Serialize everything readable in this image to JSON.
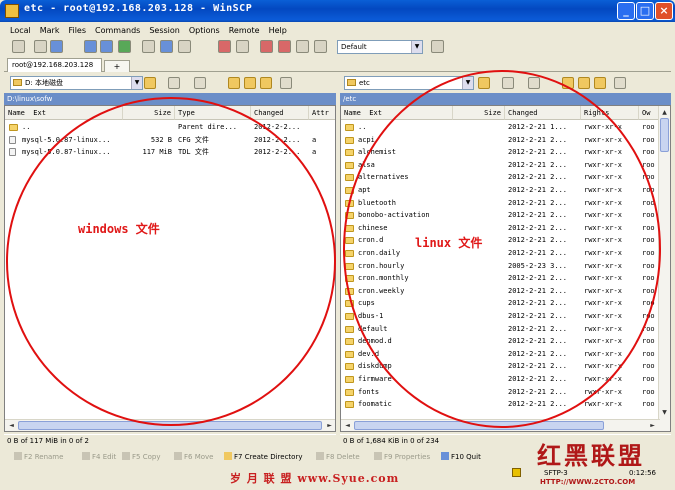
{
  "window": {
    "title": "etc - root@192.168.203.128 - WinSCP",
    "minimize": "_",
    "maximize": "□",
    "close": "×"
  },
  "menu": [
    "Local",
    "Mark",
    "Files",
    "Commands",
    "Session",
    "Options",
    "Remote",
    "Help"
  ],
  "toolbar": {
    "transfer_preset": "Default"
  },
  "tab": {
    "label": "root@192.168.203.128",
    "add": "+"
  },
  "left": {
    "path_combo": "D: 本地磁盘",
    "path": "D:\\linux\\sofw",
    "columns": [
      "Name",
      "Ext",
      "Size",
      "Type",
      "Changed",
      "Attr"
    ],
    "rows": [
      {
        "name": "..",
        "size": "",
        "type": "Parent dire...",
        "changed": "2012-2-2...",
        "attr": ""
      },
      {
        "name": "mysql-5.0.87-linux...",
        "size": "532 B",
        "type": "CFG 文件",
        "changed": "2012-2-2...",
        "attr": "a"
      },
      {
        "name": "mysql-5.0.87-linux...",
        "size": "117 MiB",
        "type": "TDL 文件",
        "changed": "2012-2-2...",
        "attr": "a"
      }
    ],
    "status": "0 B of 117 MiB in 0 of 2",
    "annotation": "windows 文件"
  },
  "right": {
    "path_combo": "etc",
    "path": "/etc",
    "columns": [
      "Name",
      "Ext",
      "Size",
      "Changed",
      "Rights",
      "Ow"
    ],
    "rows": [
      {
        "name": "..",
        "changed": "2012-2-21 1...",
        "rights": "rwxr-xr-x",
        "owner": "roo"
      },
      {
        "name": "acpi",
        "changed": "2012-2-21 2...",
        "rights": "rwxr-xr-x",
        "owner": "roo"
      },
      {
        "name": "alchemist",
        "changed": "2012-2-21 2...",
        "rights": "rwxr-xr-x",
        "owner": "roo"
      },
      {
        "name": "alsa",
        "changed": "2012-2-21 2...",
        "rights": "rwxr-xr-x",
        "owner": "roo"
      },
      {
        "name": "alternatives",
        "changed": "2012-2-21 2...",
        "rights": "rwxr-xr-x",
        "owner": "roo"
      },
      {
        "name": "apt",
        "changed": "2012-2-21 2...",
        "rights": "rwxr-xr-x",
        "owner": "roo"
      },
      {
        "name": "bluetooth",
        "changed": "2012-2-21 2...",
        "rights": "rwxr-xr-x",
        "owner": "roo"
      },
      {
        "name": "bonobo-activation",
        "changed": "2012-2-21 2...",
        "rights": "rwxr-xr-x",
        "owner": "roo"
      },
      {
        "name": "chinese",
        "changed": "2012-2-21 2...",
        "rights": "rwxr-xr-x",
        "owner": "roo"
      },
      {
        "name": "cron.d",
        "changed": "2012-2-21 2...",
        "rights": "rwxr-xr-x",
        "owner": "roo"
      },
      {
        "name": "cron.daily",
        "changed": "2012-2-21 2...",
        "rights": "rwxr-xr-x",
        "owner": "roo"
      },
      {
        "name": "cron.hourly",
        "changed": "2005-2-23 3...",
        "rights": "rwxr-xr-x",
        "owner": "roo"
      },
      {
        "name": "cron.monthly",
        "changed": "2012-2-21 2...",
        "rights": "rwxr-xr-x",
        "owner": "roo"
      },
      {
        "name": "cron.weekly",
        "changed": "2012-2-21 2...",
        "rights": "rwxr-xr-x",
        "owner": "roo"
      },
      {
        "name": "cups",
        "changed": "2012-2-21 2...",
        "rights": "rwxr-xr-x",
        "owner": "roo"
      },
      {
        "name": "dbus-1",
        "changed": "2012-2-21 2...",
        "rights": "rwxr-xr-x",
        "owner": "roo"
      },
      {
        "name": "default",
        "changed": "2012-2-21 2...",
        "rights": "rwxr-xr-x",
        "owner": "roo"
      },
      {
        "name": "depmod.d",
        "changed": "2012-2-21 2...",
        "rights": "rwxr-xr-x",
        "owner": "roo"
      },
      {
        "name": "dev.d",
        "changed": "2012-2-21 2...",
        "rights": "rwxr-xr-x",
        "owner": "roo"
      },
      {
        "name": "diskdump",
        "changed": "2012-2-21 2...",
        "rights": "rwxr-xr-x",
        "owner": "roo"
      },
      {
        "name": "firmware",
        "changed": "2012-2-21 2...",
        "rights": "rwxr-xr-x",
        "owner": "roo"
      },
      {
        "name": "fonts",
        "changed": "2012-2-21 2...",
        "rights": "rwxr-xr-x",
        "owner": "roo"
      },
      {
        "name": "foomatic",
        "changed": "2012-2-21 2...",
        "rights": "rwxr-xr-x",
        "owner": "roo"
      }
    ],
    "status": "0 B of 1,684 KiB in 0 of 234",
    "annotation": "linux 文件"
  },
  "commands": [
    {
      "key": "F2",
      "label": "Rename",
      "enabled": false
    },
    {
      "key": "F4",
      "label": "Edit",
      "enabled": false
    },
    {
      "key": "F5",
      "label": "Copy",
      "enabled": false
    },
    {
      "key": "F6",
      "label": "Move",
      "enabled": false
    },
    {
      "key": "F7",
      "label": "Create Directory",
      "enabled": true
    },
    {
      "key": "F8",
      "label": "Delete",
      "enabled": false
    },
    {
      "key": "F9",
      "label": "Properties",
      "enabled": false
    },
    {
      "key": "F10",
      "label": "Quit",
      "enabled": true
    }
  ],
  "statusbar": {
    "protocol": "SFTP-3",
    "time": "0:12:56"
  },
  "watermark": {
    "bottom_text": "岁 月 联 盟   www.Syue.com",
    "corner_logo": "红黑联盟",
    "corner_url": "HTTP://WWW.2CTO.COM"
  },
  "colors": {
    "title_blue": "#0a5fd6",
    "path_blue": "#6b8ec8",
    "annotation_red": "#e01010"
  }
}
